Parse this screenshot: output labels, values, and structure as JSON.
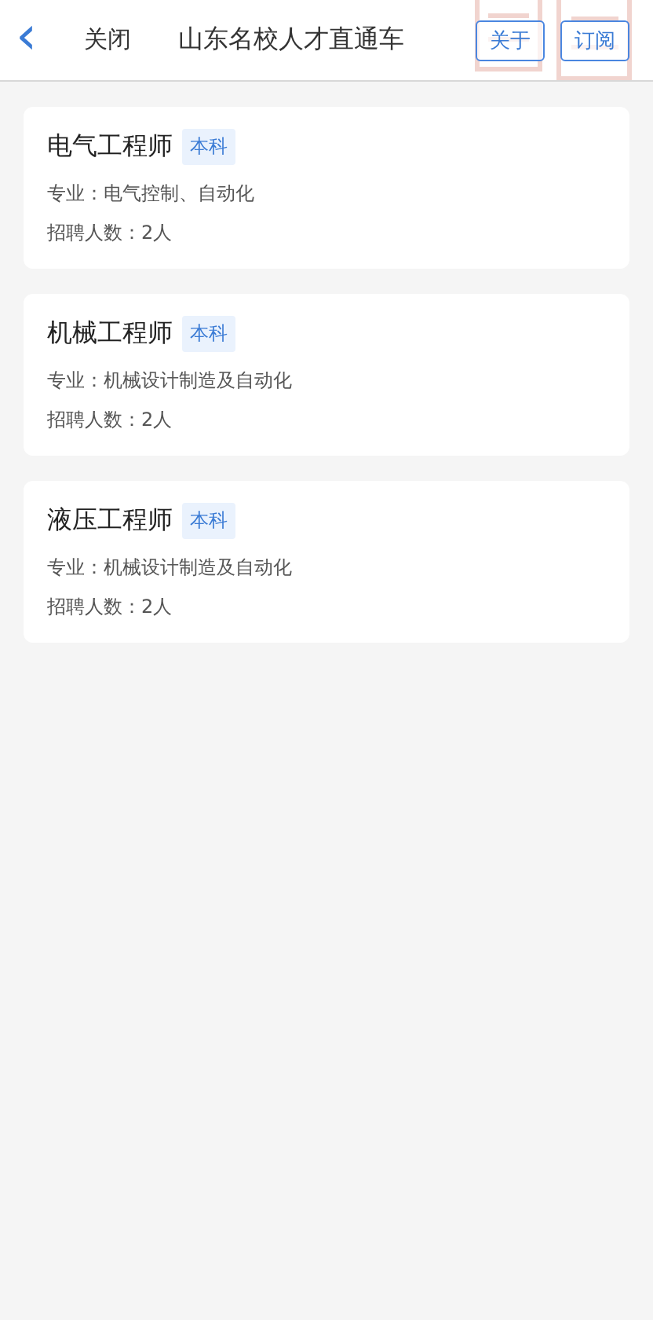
{
  "header": {
    "back": "‹",
    "close": "关闭",
    "title": "山东名校人才直通车",
    "buttons": [
      "关于",
      "订阅"
    ]
  },
  "jobs": [
    {
      "title": "电气工程师",
      "tag": "本科",
      "major": "专业：电气控制、自动化",
      "count": "招聘人数：2人"
    },
    {
      "title": "机械工程师",
      "tag": "本科",
      "major": "专业：机械设计制造及自动化",
      "count": "招聘人数：2人"
    },
    {
      "title": "液压工程师",
      "tag": "本科",
      "major": "专业：机械设计制造及自动化",
      "count": "招聘人数：2人"
    }
  ]
}
